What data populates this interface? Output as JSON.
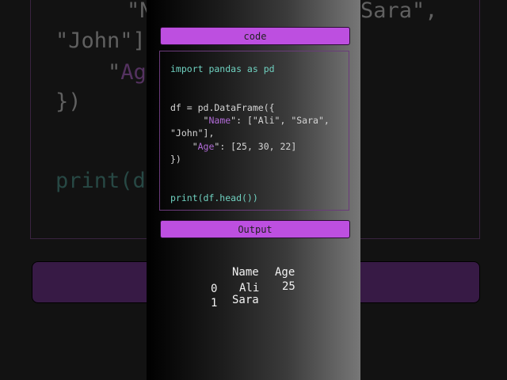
{
  "background_echo": {
    "line1a": "\"N",
    "line1b": "Sara\",",
    "line2": "\"John\"]",
    "line3_quote": "\"",
    "line3_key": "Ag",
    "line4": "})",
    "line5": "print(d"
  },
  "code_section": {
    "header_label": "code",
    "lines": {
      "import": "import pandas as pd",
      "df_open": "df = pd.DataFrame({",
      "name_indent": "      \"",
      "name_key": "Name",
      "name_rest": "\": [\"Ali\", \"Sara\",",
      "name_cont": "\"John\"],",
      "age_indent": "    \"",
      "age_key": "Age",
      "age_rest": "\": [25, 30, 22]",
      "close": "})",
      "print": "print(df.head())"
    }
  },
  "output_section": {
    "header_label": "Output",
    "columns": [
      "Name",
      "Age"
    ],
    "rows": [
      {
        "index": "0",
        "name": "Ali",
        "age": "25"
      },
      {
        "index": "1",
        "name": "Sara",
        "age": ""
      }
    ]
  },
  "colors": {
    "accent": "#bd4fe0",
    "keyword": "#6fd1c0",
    "string_key": "#b06ad6"
  }
}
